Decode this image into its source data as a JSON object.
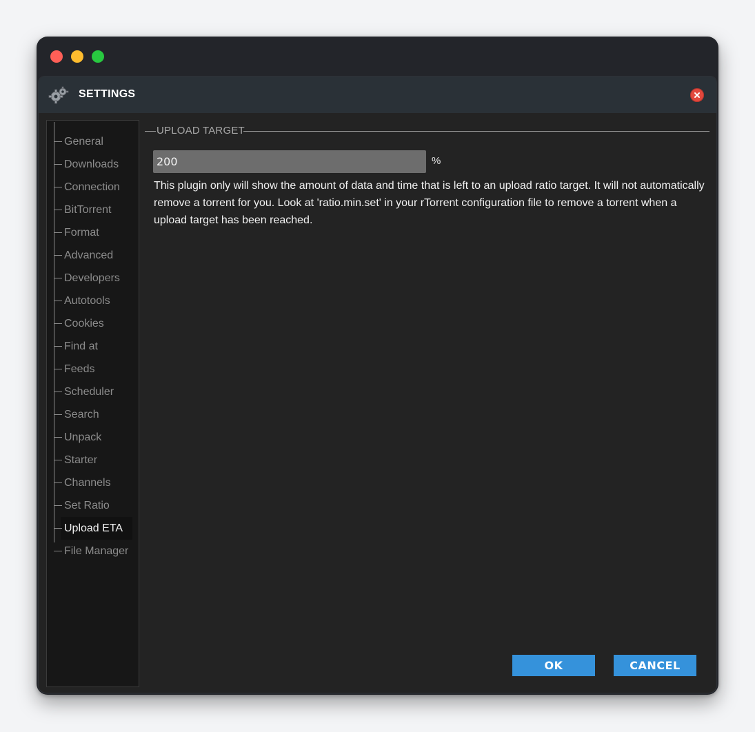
{
  "dialog": {
    "title": "SETTINGS"
  },
  "sidebar": {
    "items": [
      {
        "label": "General",
        "active": false
      },
      {
        "label": "Downloads",
        "active": false
      },
      {
        "label": "Connection",
        "active": false
      },
      {
        "label": "BitTorrent",
        "active": false
      },
      {
        "label": "Format",
        "active": false
      },
      {
        "label": "Advanced",
        "active": false
      },
      {
        "label": "Developers",
        "active": false
      },
      {
        "label": "Autotools",
        "active": false
      },
      {
        "label": "Cookies",
        "active": false
      },
      {
        "label": "Find at",
        "active": false
      },
      {
        "label": "Feeds",
        "active": false
      },
      {
        "label": "Scheduler",
        "active": false
      },
      {
        "label": "Search",
        "active": false
      },
      {
        "label": "Unpack",
        "active": false
      },
      {
        "label": "Starter",
        "active": false
      },
      {
        "label": "Channels",
        "active": false
      },
      {
        "label": "Set Ratio",
        "active": false
      },
      {
        "label": "Upload ETA",
        "active": true
      },
      {
        "label": "File Manager",
        "active": false
      }
    ]
  },
  "panel": {
    "legend": "UPLOAD TARGET",
    "input_value": "200",
    "unit": "%",
    "description": "This plugin only will show the amount of data and time that is left to an upload ratio target. It will not automatically remove a torrent for you. Look at 'ratio.min.set' in your rTorrent configuration file to remove a torrent when a upload target has been reached."
  },
  "buttons": {
    "ok": "OK",
    "cancel": "CANCEL"
  },
  "colors": {
    "accent": "#3592db",
    "close": "#e2483d"
  }
}
